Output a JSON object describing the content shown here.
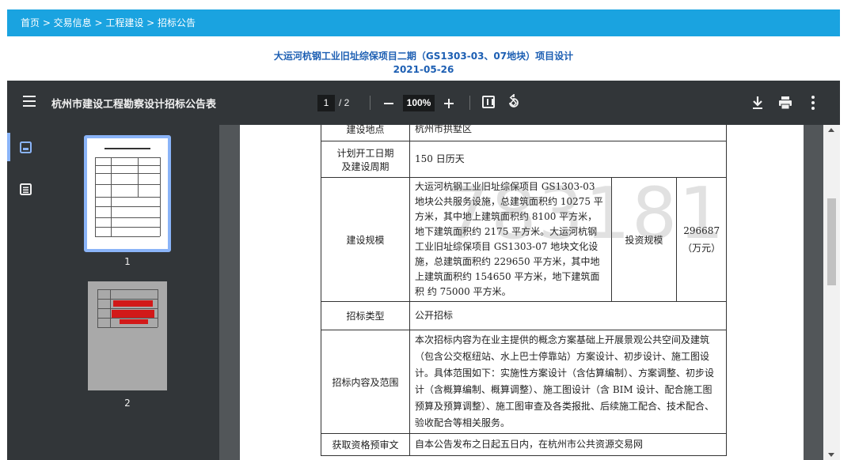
{
  "breadcrumb": {
    "text": "首页 > 交易信息 > 工程建设 > 招标公告"
  },
  "header": {
    "title_line1": "大运河杭钢工业旧址综保项目二期（GS1303-03、07地块）项目设计",
    "title_line2": "2021-05-26"
  },
  "toolbar": {
    "doc_title": "杭州市建设工程勘察设计招标公告表",
    "current_page": "1",
    "page_sep": "/ 2",
    "zoom": "100%",
    "icons": [
      "menu-icon",
      "zoom-out-icon",
      "zoom-in-icon",
      "fit-page-icon",
      "rotate-icon",
      "download-icon",
      "print-icon",
      "more-vert-icon"
    ]
  },
  "sidebar": {
    "tabs": [
      "thumbnail-view-icon",
      "outline-view-icon"
    ],
    "pages": [
      {
        "label": "1"
      },
      {
        "label": "2"
      }
    ]
  },
  "document": {
    "rows": [
      {
        "label": "建设地点",
        "value": "杭州市拱墅区"
      },
      {
        "label": "计划开工日期及建设周期",
        "label_l1": "计划开工日期",
        "label_l2": "及建设周期",
        "value": "150 日历天"
      },
      {
        "label": "建设规模",
        "value": "大运河杭钢工业旧址综保项目 GS1303-03 地块公共服务设施，总建筑面积约 10275 平方米，其中地上建筑面积约 8100 平方米，地下建筑面积约 2175 平方米。大运河杭钢工业旧址综保项目 GS1303-07 地块文化设施，总建筑面积约 229650 平方米，其中地上建筑面积约 154650 平方米，地下建筑面积 约 75000 平方米。",
        "invest_label": "投资规模",
        "invest_value": "296687",
        "invest_unit": "（万元）"
      },
      {
        "label": "招标类型",
        "value": "公开招标"
      },
      {
        "label": "招标内容及范围",
        "value": "本次招标内容为在业主提供的概念方案基础上开展景观公共空间及建筑（包含公交枢纽站、水上巴士停靠站）方案设计、初步设计、施工图设计。具体范围如下：实施性方案设计（含估算编制）、方案调整、初步设计（含概算编制、概算调整）、施工图设计（含 BIM 设计、配合施工图预算及预算调整）、施工图审查及各类报批、后续施工配合、技术配合、验收配合等相关服务。"
      },
      {
        "label": "获取资格预审文",
        "value": "自本公告发布之日起五日内，在杭州市公共资源交易网"
      }
    ],
    "watermark": "783181"
  },
  "colors": {
    "breadcrumb_bg": "#1aa3e0",
    "title_color": "#1d5fb3",
    "toolbar_bg": "#323639",
    "viewer_bg": "#525659",
    "active": "#8ab4f8"
  }
}
